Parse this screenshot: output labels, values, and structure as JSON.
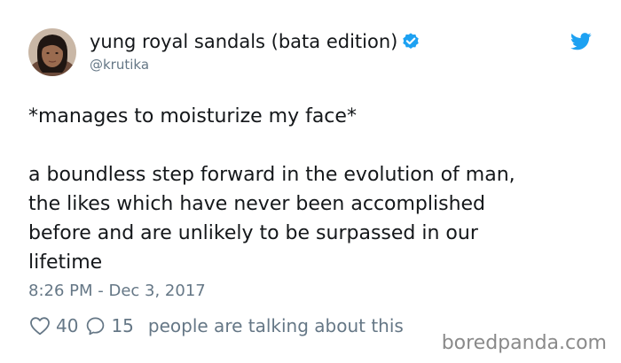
{
  "tweet": {
    "author": {
      "display_name": "yung royal sandals (bata edition)",
      "handle": "@krutika",
      "verified": true,
      "avatar_icon": "avatar-photo"
    },
    "platform_icon": "twitter-bird-icon",
    "text_line_1": "*manages to moisturize my face*",
    "text_paragraph_lines": [
      "a boundless step forward in the evolution of man,",
      "the likes which have never been accomplished",
      "before and are unlikely to be surpassed in our",
      "lifetime"
    ],
    "timestamp": "8:26 PM - Dec 3, 2017",
    "likes_count": "40",
    "replies_count": "15",
    "talking_text": "people are talking about this"
  },
  "watermark": "boredpanda.com",
  "colors": {
    "text": "#14171a",
    "secondary": "#657786",
    "twitter_blue": "#1da1f2",
    "watermark": "#8a8a8a"
  }
}
